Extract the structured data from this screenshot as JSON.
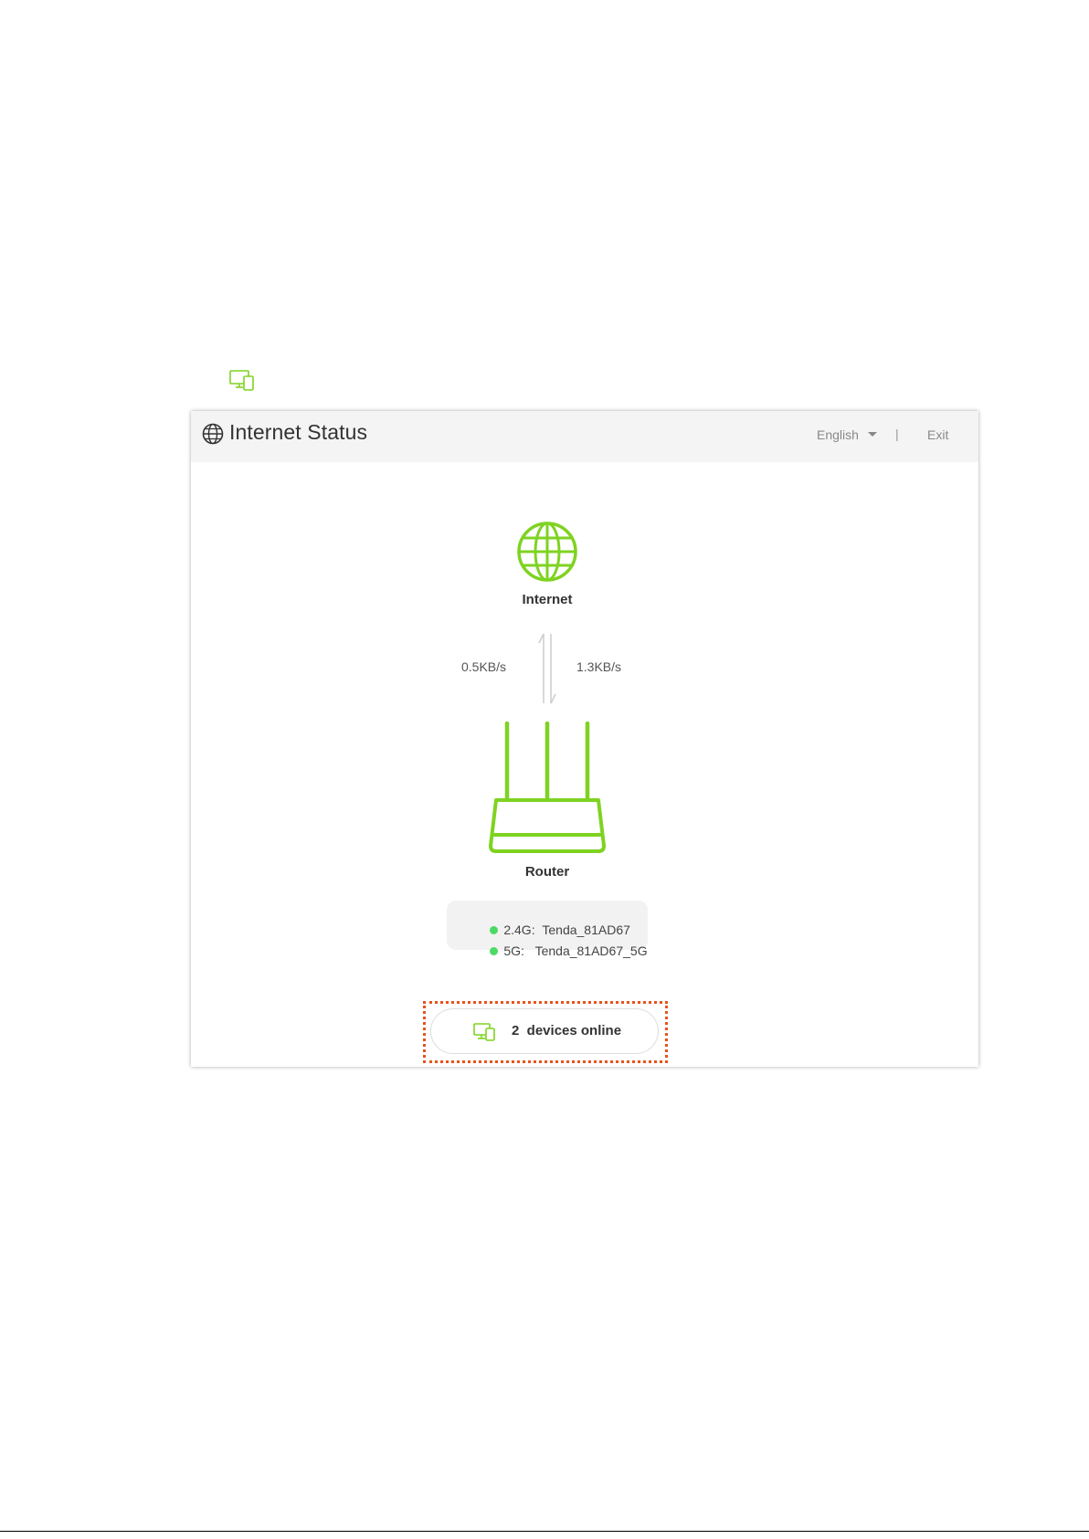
{
  "colors": {
    "accent_green": "#7ed321",
    "status_dot_green": "#4cd964",
    "highlight_orange": "#e8531c",
    "header_bg": "#f4f4f4"
  },
  "doc_icon": "devices-icon",
  "header": {
    "icon": "globe-icon",
    "title": "Internet Status",
    "language": "English",
    "separator": "|",
    "exit_label": "Exit"
  },
  "topology": {
    "internet_icon": "globe-icon",
    "internet_label": "Internet",
    "rate_left": "0.5KB/s",
    "rate_right": "1.3KB/s",
    "router_icon": "router-icon",
    "router_label": "Router"
  },
  "wifi": [
    {
      "band": "2.4G:",
      "ssid": "Tenda_81AD67",
      "status_color": "#4cd964"
    },
    {
      "band": "5G:",
      "ssid": "Tenda_81AD67_5G",
      "status_color": "#4cd964"
    }
  ],
  "devices_button": {
    "icon": "devices-icon",
    "label": "2  devices online"
  }
}
